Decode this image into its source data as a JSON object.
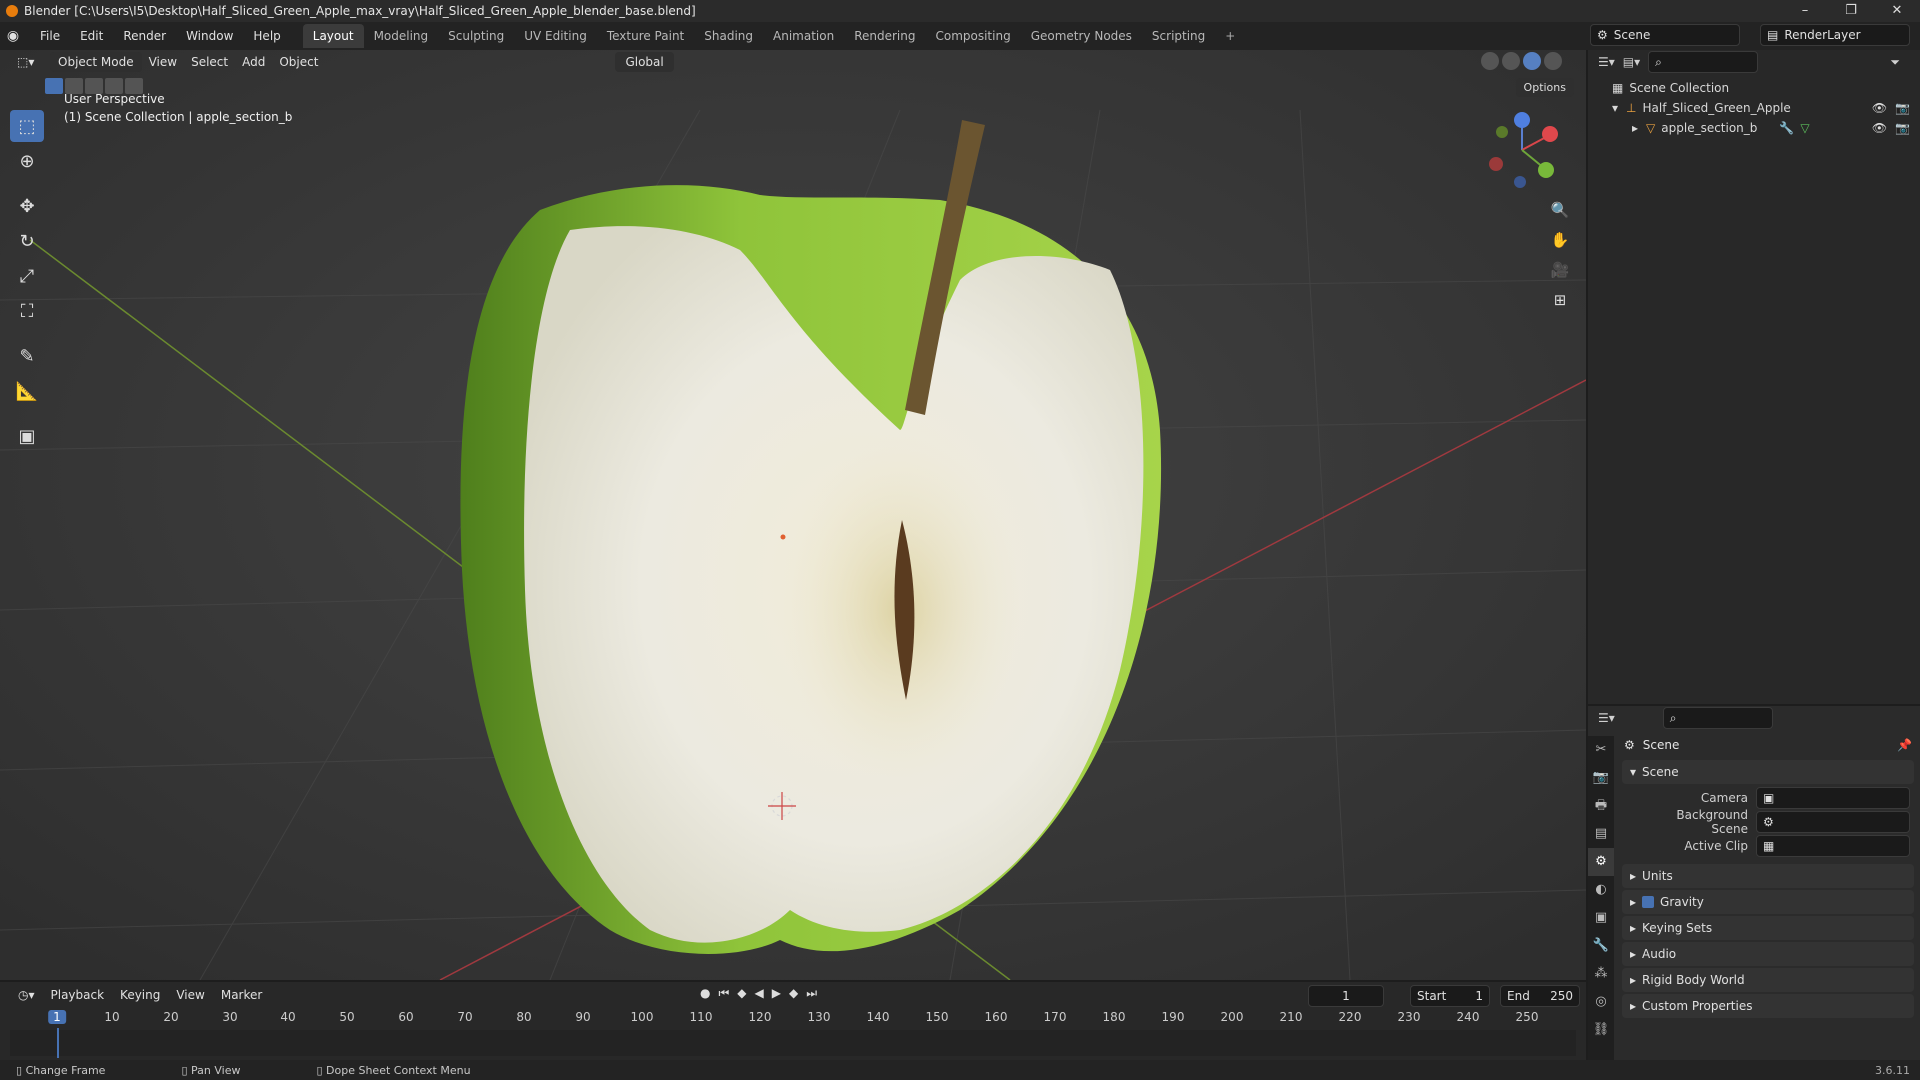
{
  "window": {
    "title": "Blender [C:\\Users\\I5\\Desktop\\Half_Sliced_Green_Apple_max_vray\\Half_Sliced_Green_Apple_blender_base.blend]",
    "controls": [
      "–",
      "❐",
      "✕"
    ]
  },
  "menu": [
    "File",
    "Edit",
    "Render",
    "Window",
    "Help"
  ],
  "workspaces": [
    "Layout",
    "Modeling",
    "Sculpting",
    "UV Editing",
    "Texture Paint",
    "Shading",
    "Animation",
    "Rendering",
    "Compositing",
    "Geometry Nodes",
    "Scripting"
  ],
  "active_workspace": "Layout",
  "scene_name": "Scene",
  "view_layer": "RenderLayer",
  "viewport": {
    "mode": "Object Mode",
    "menus": [
      "View",
      "Select",
      "Add",
      "Object"
    ],
    "orientation": "Global",
    "options_label": "Options",
    "info_line1": "User Perspective",
    "info_line2": "(1) Scene Collection | apple_section_b"
  },
  "outliner": {
    "root": "Scene Collection",
    "items": [
      "Half_Sliced_Green_Apple",
      "apple_section_b"
    ]
  },
  "properties": {
    "title": "Scene",
    "panel": "Scene",
    "fields": {
      "camera": "Camera",
      "background": "Background Scene",
      "clip": "Active Clip"
    },
    "panels": [
      "Units",
      "Gravity",
      "Keying Sets",
      "Audio",
      "Rigid Body World",
      "Custom Properties"
    ]
  },
  "timeline": {
    "menus": [
      "Playback",
      "Keying",
      "View",
      "Marker"
    ],
    "current_frame": "1",
    "start_label": "Start",
    "start": "1",
    "end_label": "End",
    "end": "250",
    "ticks": [
      "10",
      "20",
      "30",
      "40",
      "50",
      "60",
      "70",
      "80",
      "90",
      "100",
      "110",
      "120",
      "130",
      "140",
      "150",
      "160",
      "170",
      "180",
      "190",
      "200",
      "210",
      "220",
      "230",
      "240",
      "250"
    ]
  },
  "status": {
    "left": "Change Frame",
    "middle": "Pan View",
    "right": "Dope Sheet Context Menu",
    "version": "3.6.11"
  },
  "colors": {
    "accent": "#4772b3",
    "apple_skin": "#8fc43a",
    "apple_flesh": "#efece0",
    "grid_x": "#9b3a3a",
    "grid_y": "#5a7a2a"
  }
}
